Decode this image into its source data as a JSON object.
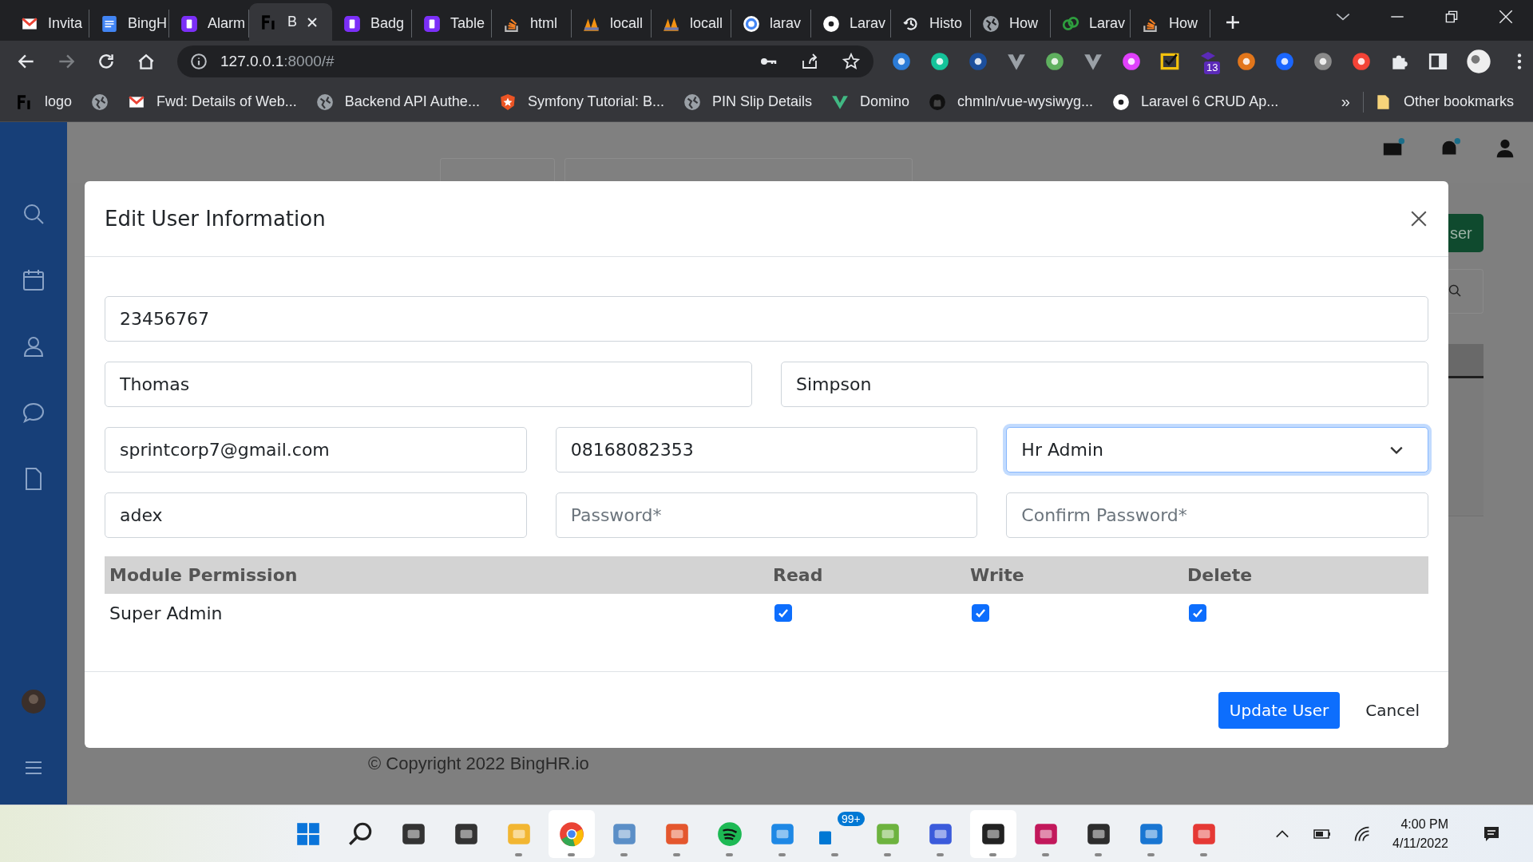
{
  "browser": {
    "tabs": [
      {
        "label": "Invita",
        "selected": false
      },
      {
        "label": "BingH",
        "selected": false
      },
      {
        "label": "Alarm",
        "selected": false
      },
      {
        "label": "B",
        "selected": true
      },
      {
        "label": "Badg",
        "selected": false
      },
      {
        "label": "Table",
        "selected": false
      },
      {
        "label": "html",
        "selected": false
      },
      {
        "label": "locall",
        "selected": false
      },
      {
        "label": "locall",
        "selected": false
      },
      {
        "label": "larav",
        "selected": false
      },
      {
        "label": "Larav",
        "selected": false
      },
      {
        "label": "Histo",
        "selected": false
      },
      {
        "label": "How",
        "selected": false
      },
      {
        "label": "Larav",
        "selected": false
      },
      {
        "label": "How",
        "selected": false
      }
    ],
    "address": {
      "host": "127.0.0.1",
      "path": ":8000/#"
    },
    "extension_badge": "13",
    "bookmarks": [
      {
        "label": "logo"
      },
      {
        "label": "Fwd: Details of Web..."
      },
      {
        "label": "Backend API Authe..."
      },
      {
        "label": "Symfony Tutorial: B..."
      },
      {
        "label": "PIN Slip Details"
      },
      {
        "label": "Domino"
      },
      {
        "label": "chmln/vue-wysiwyg..."
      },
      {
        "label": "Laravel 6 CRUD Ap..."
      }
    ],
    "bookmarks_overflow": "»",
    "other_bookmarks": "Other bookmarks"
  },
  "background": {
    "button_text": "ser",
    "copyright": "© Copyright 2022 BingHR.io"
  },
  "modal": {
    "title": "Edit User Information",
    "field_rows": [
      [
        {
          "kind": "text",
          "value": "23456767",
          "focused": false
        }
      ],
      [
        {
          "kind": "text",
          "value": "Thomas",
          "focused": false
        },
        {
          "kind": "text",
          "value": "Simpson",
          "focused": false
        }
      ],
      [
        {
          "kind": "text",
          "value": "sprintcorp7@gmail.com",
          "focused": false
        },
        {
          "kind": "text",
          "value": "08168082353",
          "focused": false
        },
        {
          "kind": "select",
          "value": "Hr Admin",
          "focused": true
        }
      ],
      [
        {
          "kind": "text",
          "value": "adex",
          "focused": false
        },
        {
          "kind": "password",
          "placeholder": "Password*",
          "focused": false
        },
        {
          "kind": "password",
          "placeholder": "Confirm Password*",
          "focused": false
        }
      ]
    ],
    "permissions": {
      "columns": [
        "Module Permission",
        "Read",
        "Write",
        "Delete"
      ],
      "rows": [
        {
          "module": "Super Admin",
          "read": true,
          "write": true,
          "delete": true
        }
      ]
    },
    "buttons": {
      "primary": "Update User",
      "secondary": "Cancel"
    }
  },
  "taskbar": {
    "badge": "99+",
    "time": "4:00 PM",
    "date": "4/11/2022"
  }
}
